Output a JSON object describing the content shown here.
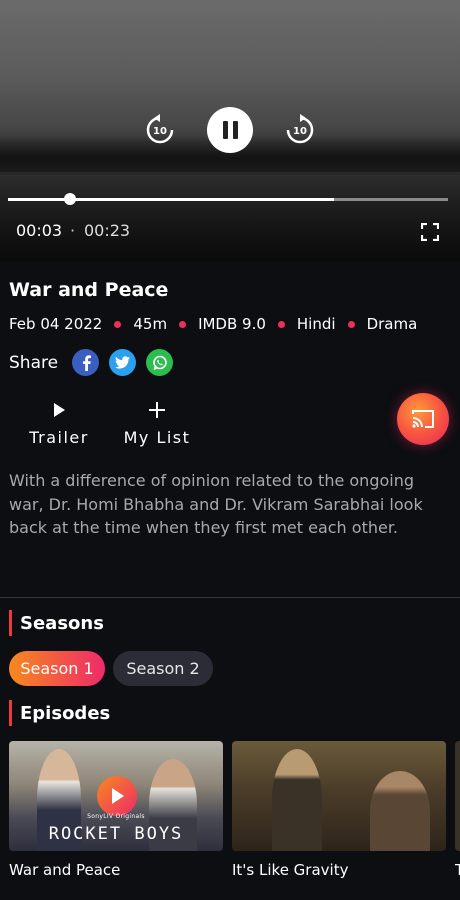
{
  "player": {
    "current_time": "00:03",
    "separator": "·",
    "duration": "00:23",
    "progress_fraction": 0.14,
    "buffered_fraction": 0.74,
    "rewind_seconds": "10",
    "forward_seconds": "10"
  },
  "show": {
    "title": "War and Peace",
    "meta": [
      "Feb 04 2022",
      "45m",
      "IMDB 9.0",
      "Hindi",
      "Drama"
    ],
    "share_label": "Share",
    "social": [
      "facebook-icon",
      "twitter-icon",
      "whatsapp-icon"
    ],
    "actions": {
      "trailer": "Trailer",
      "my_list": "My List"
    },
    "description": "With a difference of opinion related to the ongoing war, Dr. Homi Bhabha and Dr. Vikram Sarabhai look back at the time when they first met each other."
  },
  "seasons": {
    "heading": "Seasons",
    "items": [
      "Season 1",
      "Season 2"
    ],
    "selected": "Season 1"
  },
  "episodes": {
    "heading": "Episodes",
    "items": [
      {
        "title": "War and Peace",
        "brand_small": "SonyLIV Originals",
        "brand_big": "ROCKET BOYS"
      },
      {
        "title": "It's Like Gravity"
      },
      {
        "title": "T"
      }
    ]
  },
  "colors": {
    "accent": "#ee2e5c",
    "gradient_start": "#f7891e",
    "gradient_end": "#ee2a6a",
    "background": "#0d0e12"
  }
}
